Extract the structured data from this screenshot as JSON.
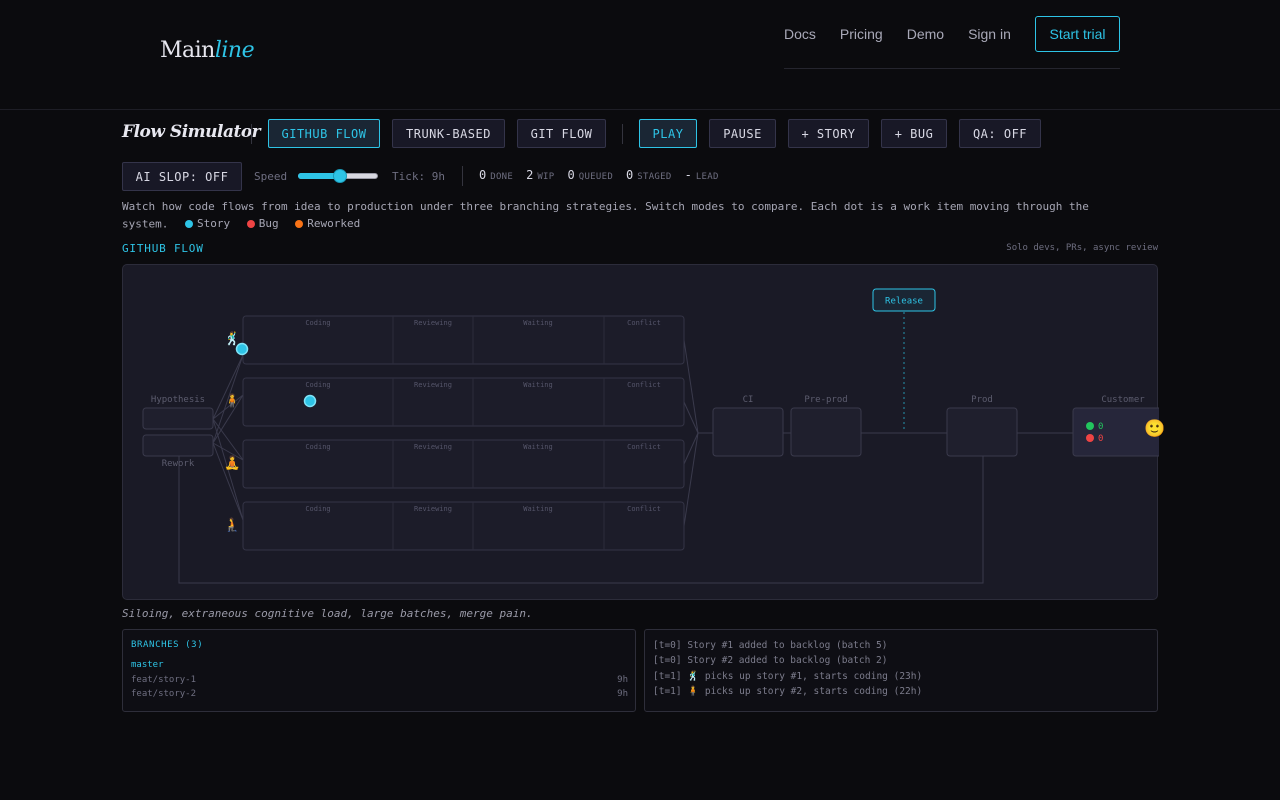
{
  "nav": {
    "logo_main": "Main",
    "logo_accent": "line",
    "links": [
      "Docs",
      "Pricing",
      "Demo",
      "Sign in"
    ],
    "cta": "Start trial"
  },
  "toolbar": {
    "title": "Flow Simulator",
    "modes": [
      "GITHUB FLOW",
      "TRUNK-BASED",
      "GIT FLOW"
    ],
    "active_mode": "GITHUB FLOW",
    "play": "PLAY",
    "pause": "PAUSE",
    "add_story": "+ STORY",
    "add_bug": "+ BUG",
    "qa": "QA: OFF",
    "ai_slop": "AI SLOP: OFF",
    "speed_label": "Speed",
    "speed_value": 0.45,
    "tick": "Tick: 9h"
  },
  "stats": [
    {
      "value": "0",
      "label": "DONE"
    },
    {
      "value": "2",
      "label": "WIP"
    },
    {
      "value": "0",
      "label": "QUEUED"
    },
    {
      "value": "0",
      "label": "STAGED"
    },
    {
      "value": "-",
      "label": "LEAD"
    }
  ],
  "description": "Watch how code flows from idea to production under three branching strategies. Switch modes to compare. Each dot is a work item moving through the system.",
  "legend": [
    {
      "label": "Story",
      "color": "#2ec4e6"
    },
    {
      "label": "Bug",
      "color": "#ef4444"
    },
    {
      "label": "Reworked",
      "color": "#f97316"
    }
  ],
  "mode": {
    "name": "GITHUB FLOW",
    "subtitle": "Solo devs, PRs, async review"
  },
  "diagram": {
    "hypothesis": "Hypothesis",
    "rework": "Rework",
    "lane_stages": [
      "Coding",
      "Reviewing",
      "Waiting",
      "Conflict"
    ],
    "ci": "CI",
    "preprod": "Pre-prod",
    "prod": "Prod",
    "customer": "Customer",
    "release": "Release",
    "customer_ok": "0",
    "customer_bad": "0",
    "customer_face": "🙂",
    "devs": [
      "🕺",
      "🧍",
      "🧘",
      "🧎"
    ]
  },
  "caption": "Siloing, extraneous cognitive load, large batches, merge pain.",
  "branches": {
    "title": "BRANCHES (3)",
    "rows": [
      {
        "name": "master",
        "age": ""
      },
      {
        "name": "feat/story-1",
        "age": "9h"
      },
      {
        "name": "feat/story-2",
        "age": "9h"
      }
    ]
  },
  "log": [
    "[t=0] Story #1 added to backlog (batch 5)",
    "[t=0] Story #2 added to backlog (batch 2)",
    "[t=1] 🕺 picks up story #1, starts coding (23h)",
    "[t=1] 🧍 picks up story #2, starts coding (22h)"
  ],
  "colors": {
    "accent": "#2ec4e6",
    "ok": "#22c55e",
    "bad": "#ef4444",
    "reworked": "#f97316"
  }
}
